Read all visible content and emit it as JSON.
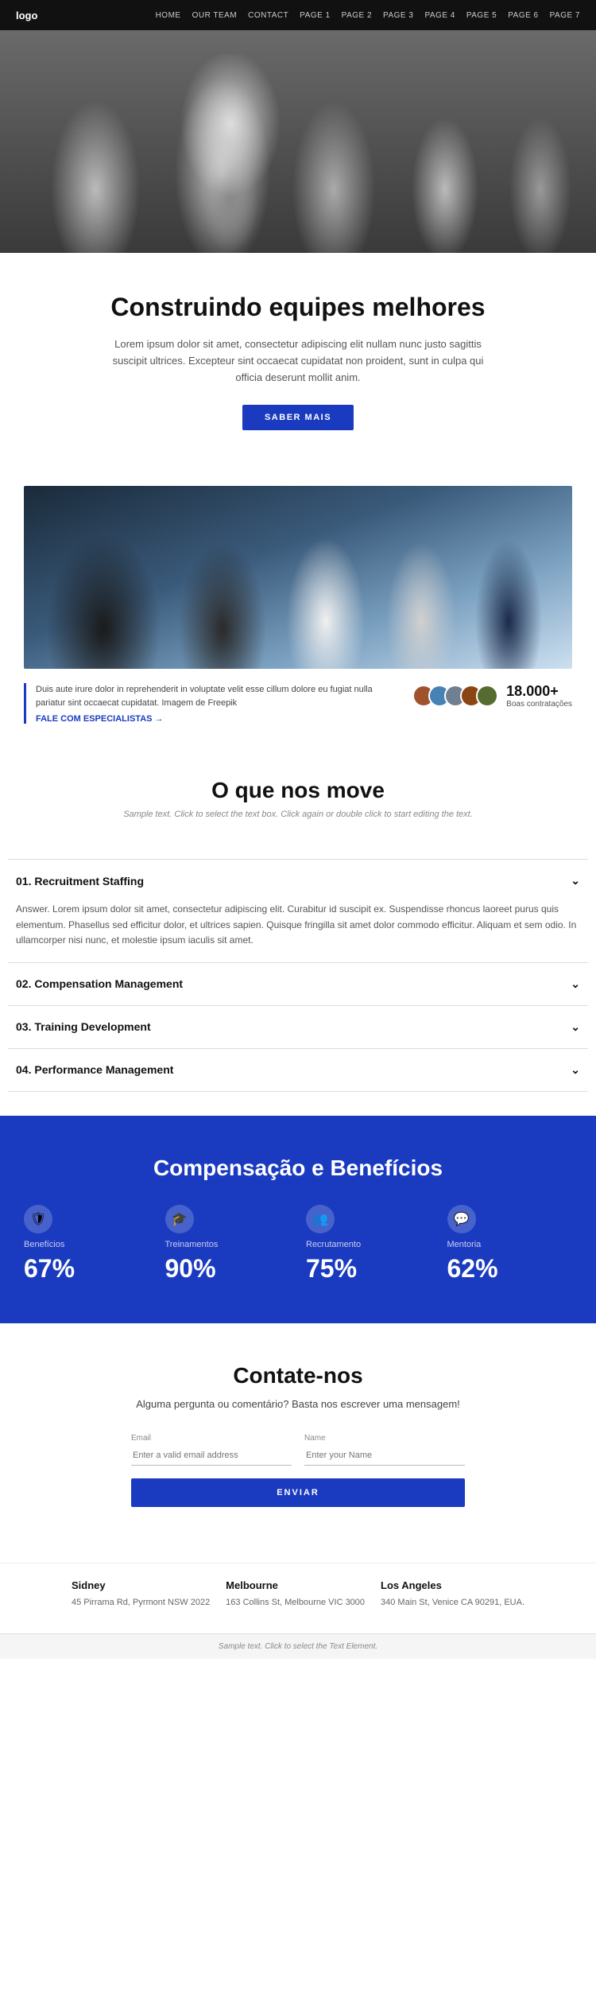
{
  "nav": {
    "logo": "logo",
    "links": [
      "HOME",
      "OUR TEAM",
      "CONTACT",
      "PAGE 1",
      "PAGE 2",
      "PAGE 3",
      "PAGE 4",
      "PAGE 5",
      "PAGE 6",
      "PAGE 7"
    ]
  },
  "intro": {
    "heading": "Construindo equipes melhores",
    "body": "Lorem ipsum dolor sit amet, consectetur adipiscing elit nullam nunc justo sagittis suscipit ultrices. Excepteur sint occaecat cupidatat non proident, sunt in culpa qui officia deserunt mollit anim.",
    "cta": "SABER MAIS"
  },
  "stats": {
    "text": "Duis aute irure dolor in reprehenderit in voluptate velit esse cillum dolore eu fugiat nulla pariatur sint occaecat cupidatat. Imagem de Freepik",
    "link": "FALE COM ESPECIALISTAS →",
    "count": "18.000+",
    "count_label": "Boas contratações"
  },
  "move": {
    "heading": "O que nos move",
    "subtitle": "Sample text. Click to select the text box. Click again or double click to start editing the text.",
    "accordion": [
      {
        "id": "acc1",
        "label": "01. Recruitment Staffing",
        "open": true,
        "body": "Answer. Lorem ipsum dolor sit amet, consectetur adipiscing elit. Curabitur id suscipit ex. Suspendisse rhoncus laoreet purus quis elementum. Phasellus sed efficitur dolor, et ultrices sapien. Quisque fringilla sit amet dolor commodo efficitur. Aliquam et sem odio. In ullamcorper nisi nunc, et molestie ipsum iaculis sit amet."
      },
      {
        "id": "acc2",
        "label": "02. Compensation Management",
        "open": false,
        "body": ""
      },
      {
        "id": "acc3",
        "label": "03. Training Development",
        "open": false,
        "body": ""
      },
      {
        "id": "acc4",
        "label": "04. Performance Management",
        "open": false,
        "body": ""
      }
    ]
  },
  "comp": {
    "heading": "Compensação e Benefícios",
    "items": [
      {
        "icon": "🛡",
        "label": "Benefícios",
        "percent": "67%"
      },
      {
        "icon": "🎓",
        "label": "Treinamentos",
        "percent": "90%"
      },
      {
        "icon": "👥",
        "label": "Recrutamento",
        "percent": "75%"
      },
      {
        "icon": "💬",
        "label": "Mentoria",
        "percent": "62%"
      }
    ]
  },
  "contact": {
    "heading": "Contate-nos",
    "subtext": "Alguma pergunta ou comentário? Basta nos escrever uma mensagem!",
    "email_label": "Email",
    "email_placeholder": "Enter a valid email address",
    "name_label": "Name",
    "name_placeholder": "Enter your Name",
    "cta": "ENVIAR",
    "offices": [
      {
        "city": "Sidney",
        "address": "45 Pirrama Rd, Pyrmont NSW 2022"
      },
      {
        "city": "Melbourne",
        "address": "163 Collins St, Melbourne VIC 3000"
      },
      {
        "city": "Los Angeles",
        "address": "340 Main St, Venice CA 90291, EUA."
      }
    ]
  },
  "footer": {
    "text": "Sample text. Click to select the Text Element."
  }
}
